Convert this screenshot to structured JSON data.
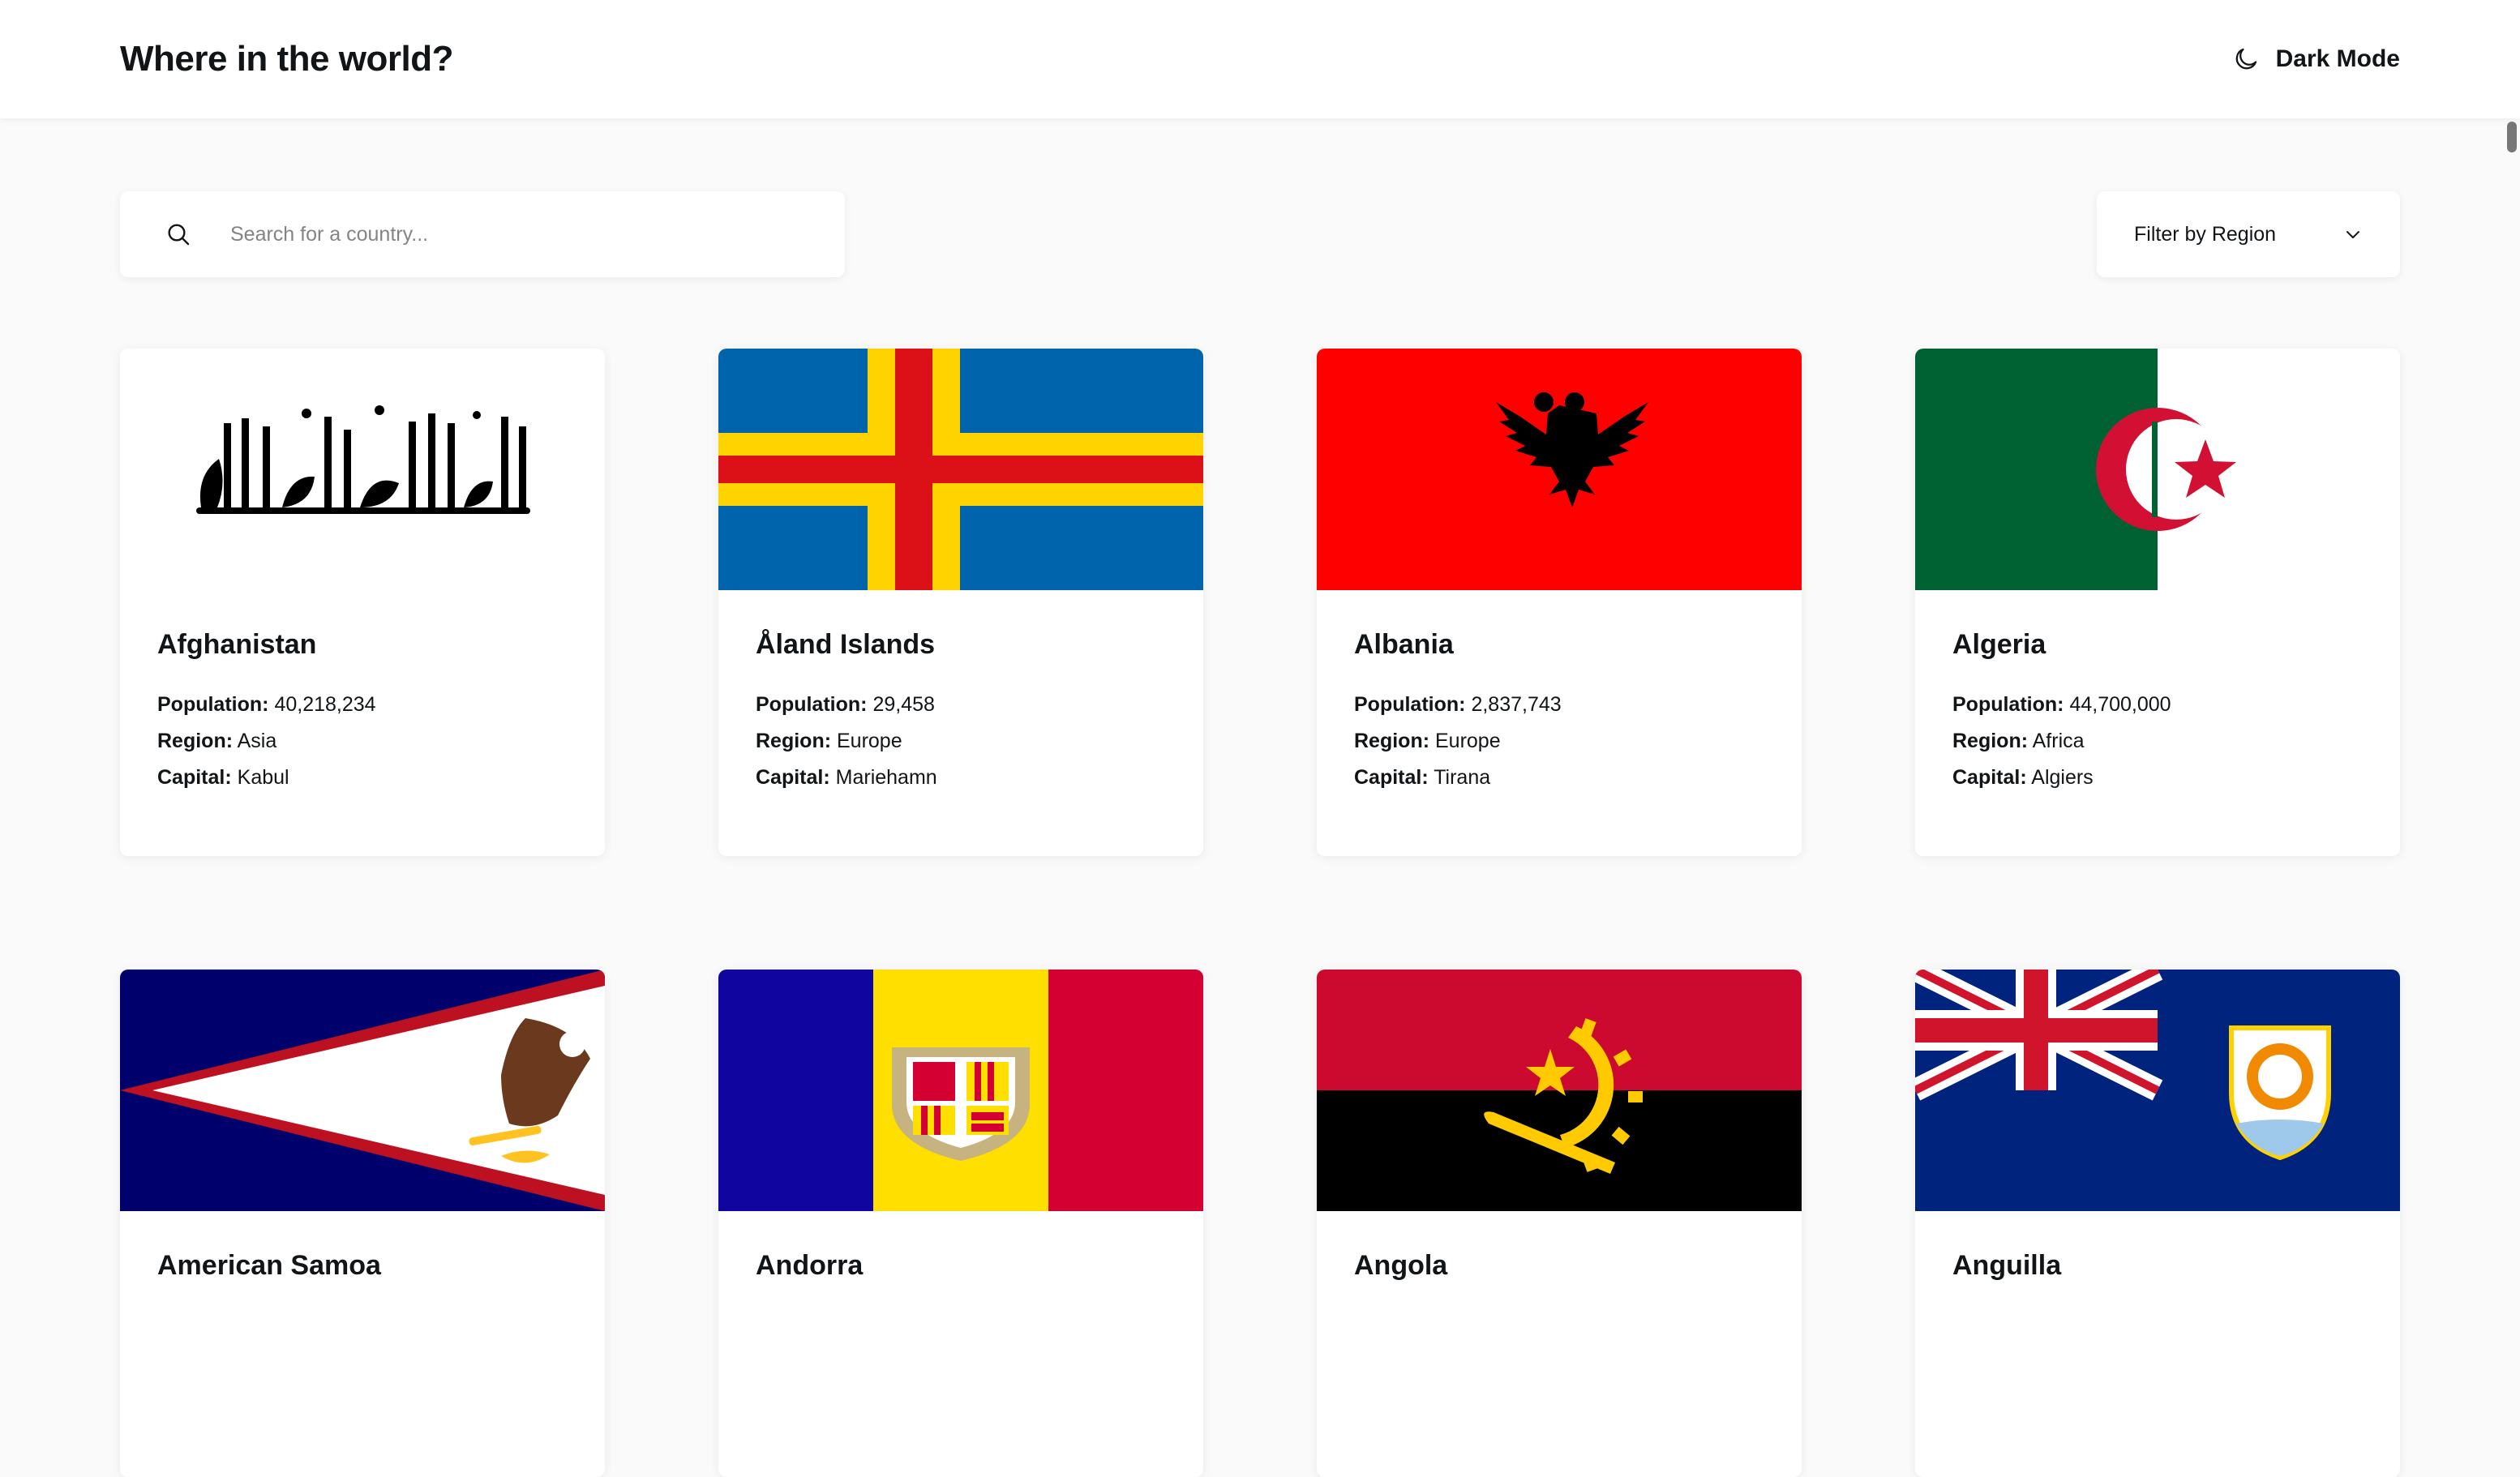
{
  "header": {
    "title": "Where in the world?",
    "dark_mode_label": "Dark Mode",
    "dark_mode_icon": "moon-icon"
  },
  "search": {
    "placeholder": "Search for a country...",
    "value": "",
    "icon": "search-icon"
  },
  "filter": {
    "label": "Filter by Region",
    "icon": "chevron-down-icon"
  },
  "labels": {
    "population": "Population:",
    "region": "Region:",
    "capital": "Capital:"
  },
  "countries": [
    {
      "name": "Afghanistan",
      "population": "40,218,234",
      "region": "Asia",
      "capital": "Kabul"
    },
    {
      "name": "Åland Islands",
      "population": "29,458",
      "region": "Europe",
      "capital": "Mariehamn"
    },
    {
      "name": "Albania",
      "population": "2,837,743",
      "region": "Europe",
      "capital": "Tirana"
    },
    {
      "name": "Algeria",
      "population": "44,700,000",
      "region": "Africa",
      "capital": "Algiers"
    },
    {
      "name": "American Samoa"
    },
    {
      "name": "Andorra"
    },
    {
      "name": "Angola"
    },
    {
      "name": "Anguilla"
    }
  ],
  "colors": {
    "background": "#fafafa",
    "surface": "#ffffff",
    "text": "#111517",
    "placeholder": "#848484"
  }
}
